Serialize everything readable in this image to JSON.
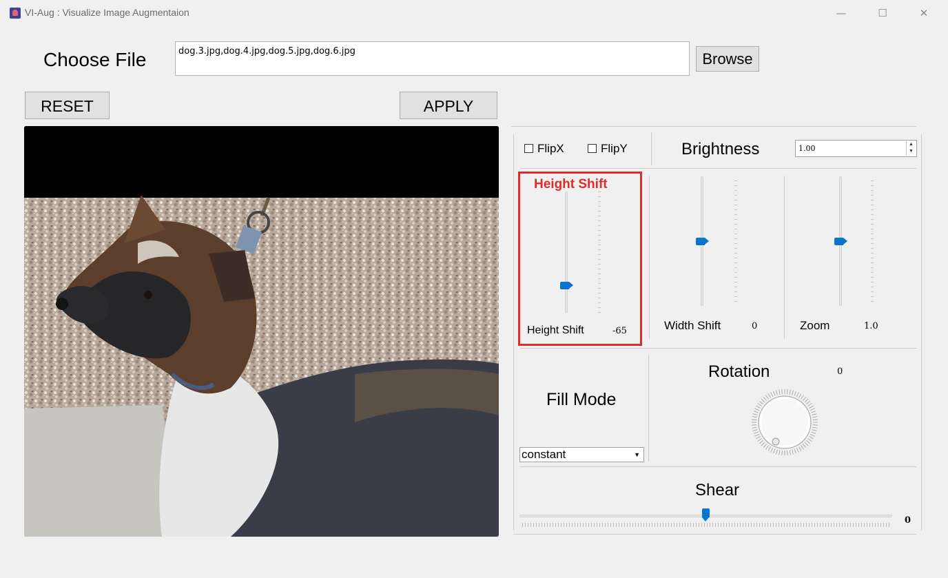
{
  "window": {
    "title": "VI-Aug : Visualize Image Augmentaion",
    "minimize": "—",
    "maximize": "☐",
    "close": "✕"
  },
  "file": {
    "label": "Choose File",
    "value": "dog.3.jpg,dog.4.jpg,dog.5.jpg,dog.6.jpg",
    "browse_label": "Browse"
  },
  "actions": {
    "reset_label": "RESET",
    "apply_label": "APPLY"
  },
  "flips": {
    "flipx_label": "FlipX",
    "flipx_checked": false,
    "flipy_label": "FlipY",
    "flipy_checked": false
  },
  "brightness": {
    "label": "Brightness",
    "value": "1.00"
  },
  "height_shift": {
    "highlight_title": "Height Shift",
    "label": "Height Shift",
    "value": "-65",
    "level": 0.17
  },
  "width_shift": {
    "label": "Width Shift",
    "value": "0",
    "level": 0.5
  },
  "zoom": {
    "label": "Zoom",
    "value": "1.0",
    "level": 0.5
  },
  "fill_mode": {
    "label": "Fill Mode",
    "selected": "constant"
  },
  "rotation": {
    "label": "Rotation",
    "value": "0"
  },
  "shear": {
    "label": "Shear",
    "value": "0",
    "level": 0.5
  },
  "colors": {
    "accent": "#0a74d1",
    "highlight": "#e02b2b"
  }
}
